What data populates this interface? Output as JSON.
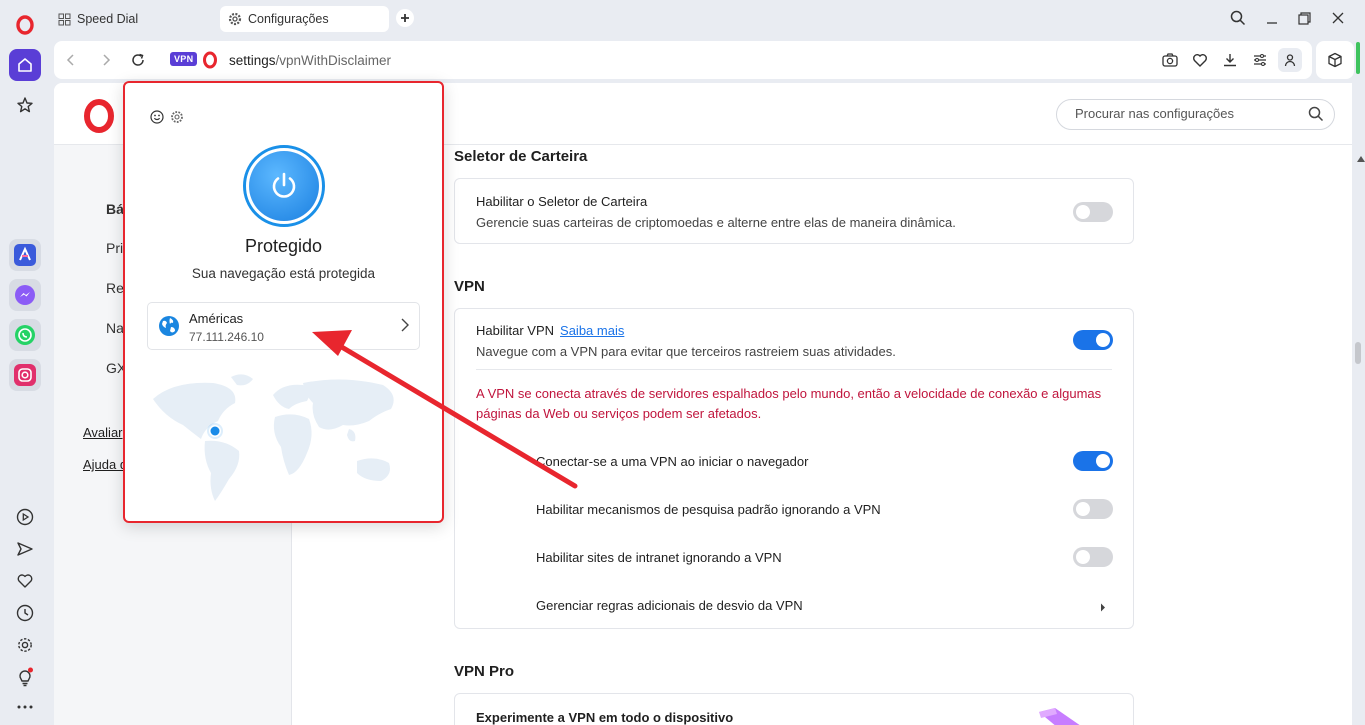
{
  "tabs": [
    {
      "label": "Speed Dial",
      "active": false
    },
    {
      "label": "Configurações",
      "active": true
    }
  ],
  "address": {
    "vpn_badge": "VPN",
    "url_host": "settings",
    "url_path": "/vpnWithDisclaimer"
  },
  "search": {
    "placeholder": "Procurar nas configurações"
  },
  "left_nav": {
    "items": [
      "Bá",
      "Pri",
      "Re",
      "Na",
      "GX"
    ],
    "links": [
      "Avaliar",
      "Ajuda d"
    ]
  },
  "vpn_popup": {
    "title": "Protegido",
    "subtitle": "Sua navegação está protegida",
    "location_name": "Américas",
    "ip": "77.111.246.10"
  },
  "sections": {
    "wallet": {
      "title": "Seletor de Carteira",
      "row_title": "Habilitar o Seletor de Carteira",
      "row_sub": "Gerencie suas carteiras de criptomoedas e alterne entre elas de maneira dinâmica.",
      "enabled": false
    },
    "vpn": {
      "title": "VPN",
      "enable_title": "Habilitar VPN",
      "learn_more": "Saiba mais",
      "enable_sub": "Navegue com a VPN para evitar que terceiros rastreiem suas atividades.",
      "enabled": true,
      "warning": "A VPN se conecta através de servidores espalhados pelo mundo, então a velocidade de conexão e algumas páginas da Web ou serviços podem ser afetados.",
      "opt_connect_start": "Conectar-se a uma VPN ao iniciar o navegador",
      "opt_connect_start_on": true,
      "opt_bypass_search": "Habilitar mecanismos de pesquisa padrão ignorando a VPN",
      "opt_bypass_search_on": false,
      "opt_intranet": "Habilitar sites de intranet ignorando a VPN",
      "opt_intranet_on": false,
      "opt_bypass_rules": "Gerenciar regras adicionais de desvio da VPN"
    },
    "vpn_pro": {
      "title": "VPN Pro",
      "row_title": "Experimente a VPN em todo o dispositivo"
    }
  },
  "colors": {
    "accent": "#1a73e8",
    "opera_red": "#e8262e",
    "vpn_badge": "#5a3ed6",
    "warning": "#c0143c"
  }
}
